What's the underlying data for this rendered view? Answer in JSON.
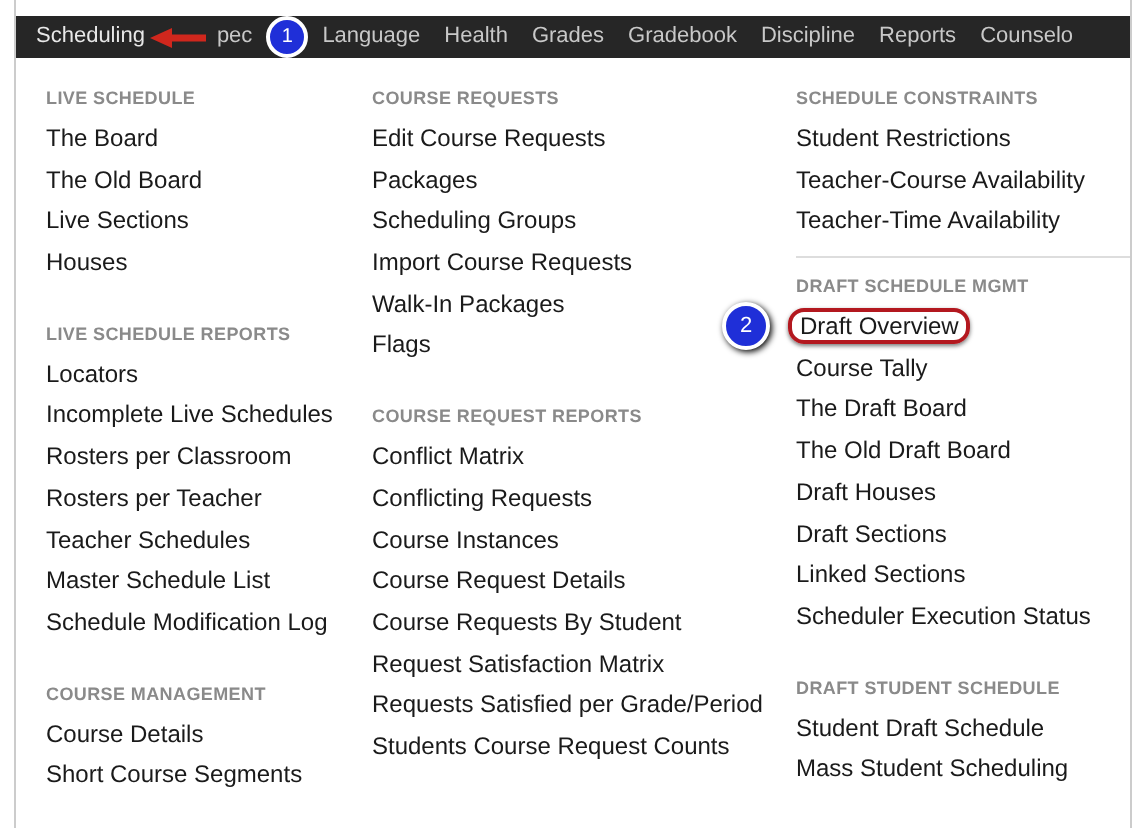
{
  "nav": {
    "items": [
      {
        "label": "Scheduling",
        "selected": true
      },
      {
        "label": "pec",
        "selected": false
      },
      {
        "label": "Language",
        "selected": false
      },
      {
        "label": "Health",
        "selected": false
      },
      {
        "label": "Grades",
        "selected": false
      },
      {
        "label": "Gradebook",
        "selected": false
      },
      {
        "label": "Discipline",
        "selected": false
      },
      {
        "label": "Reports",
        "selected": false
      },
      {
        "label": "Counselo",
        "selected": false
      }
    ]
  },
  "columns": [
    {
      "sections": [
        {
          "title": "LIVE SCHEDULE",
          "items": [
            {
              "label": "The Board",
              "circled": false
            },
            {
              "label": "The Old Board",
              "circled": false
            },
            {
              "label": "Live Sections",
              "circled": false
            },
            {
              "label": "Houses",
              "circled": false
            }
          ]
        },
        {
          "title": "LIVE SCHEDULE REPORTS",
          "items": [
            {
              "label": "Locators",
              "circled": false
            },
            {
              "label": "Incomplete Live Schedules",
              "circled": false
            },
            {
              "label": "Rosters per Classroom",
              "circled": false
            },
            {
              "label": "Rosters per Teacher",
              "circled": false
            },
            {
              "label": "Teacher Schedules",
              "circled": false
            },
            {
              "label": "Master Schedule List",
              "circled": false
            },
            {
              "label": "Schedule Modification Log",
              "circled": false
            }
          ]
        },
        {
          "title": "COURSE MANAGEMENT",
          "items": [
            {
              "label": "Course Details",
              "circled": false
            },
            {
              "label": "Short Course Segments",
              "circled": false
            }
          ]
        }
      ]
    },
    {
      "sections": [
        {
          "title": "COURSE REQUESTS",
          "items": [
            {
              "label": "Edit Course Requests",
              "circled": false
            },
            {
              "label": "Packages",
              "circled": false
            },
            {
              "label": "Scheduling Groups",
              "circled": false
            },
            {
              "label": "Import Course Requests",
              "circled": false
            },
            {
              "label": "Walk-In Packages",
              "circled": false
            },
            {
              "label": "Flags",
              "circled": false
            }
          ]
        },
        {
          "title": "COURSE REQUEST REPORTS",
          "items": [
            {
              "label": "Conflict Matrix",
              "circled": false
            },
            {
              "label": "Conflicting Requests",
              "circled": false
            },
            {
              "label": "Course Instances",
              "circled": false
            },
            {
              "label": "Course Request Details",
              "circled": false
            },
            {
              "label": "Course Requests By Student",
              "circled": false
            },
            {
              "label": "Request Satisfaction Matrix",
              "circled": false
            },
            {
              "label": "Requests Satisfied per Grade/Period",
              "circled": false
            },
            {
              "label": "Students Course Request Counts",
              "circled": false
            }
          ]
        }
      ]
    },
    {
      "sections": [
        {
          "title": "SCHEDULE CONSTRAINTS",
          "items": [
            {
              "label": "Student Restrictions",
              "circled": false
            },
            {
              "label": "Teacher-Course Availability",
              "circled": false
            },
            {
              "label": "Teacher-Time Availability",
              "circled": false
            }
          ]
        },
        {
          "title": "DRAFT SCHEDULE MGMT",
          "items": [
            {
              "label": "Draft Overview",
              "circled": true
            },
            {
              "label": "Course Tally",
              "circled": false
            },
            {
              "label": "The Draft Board",
              "circled": false
            },
            {
              "label": "The Old Draft Board",
              "circled": false
            },
            {
              "label": "Draft Houses",
              "circled": false
            },
            {
              "label": "Draft Sections",
              "circled": false
            },
            {
              "label": "Linked Sections",
              "circled": false
            },
            {
              "label": "Scheduler Execution Status",
              "circled": false
            }
          ]
        },
        {
          "title": "DRAFT STUDENT SCHEDULE",
          "items": [
            {
              "label": "Student Draft Schedule",
              "circled": false
            },
            {
              "label": "Mass Student Scheduling",
              "circled": false
            }
          ]
        }
      ]
    }
  ],
  "annotations": [
    {
      "number": "1"
    },
    {
      "number": "2"
    }
  ]
}
